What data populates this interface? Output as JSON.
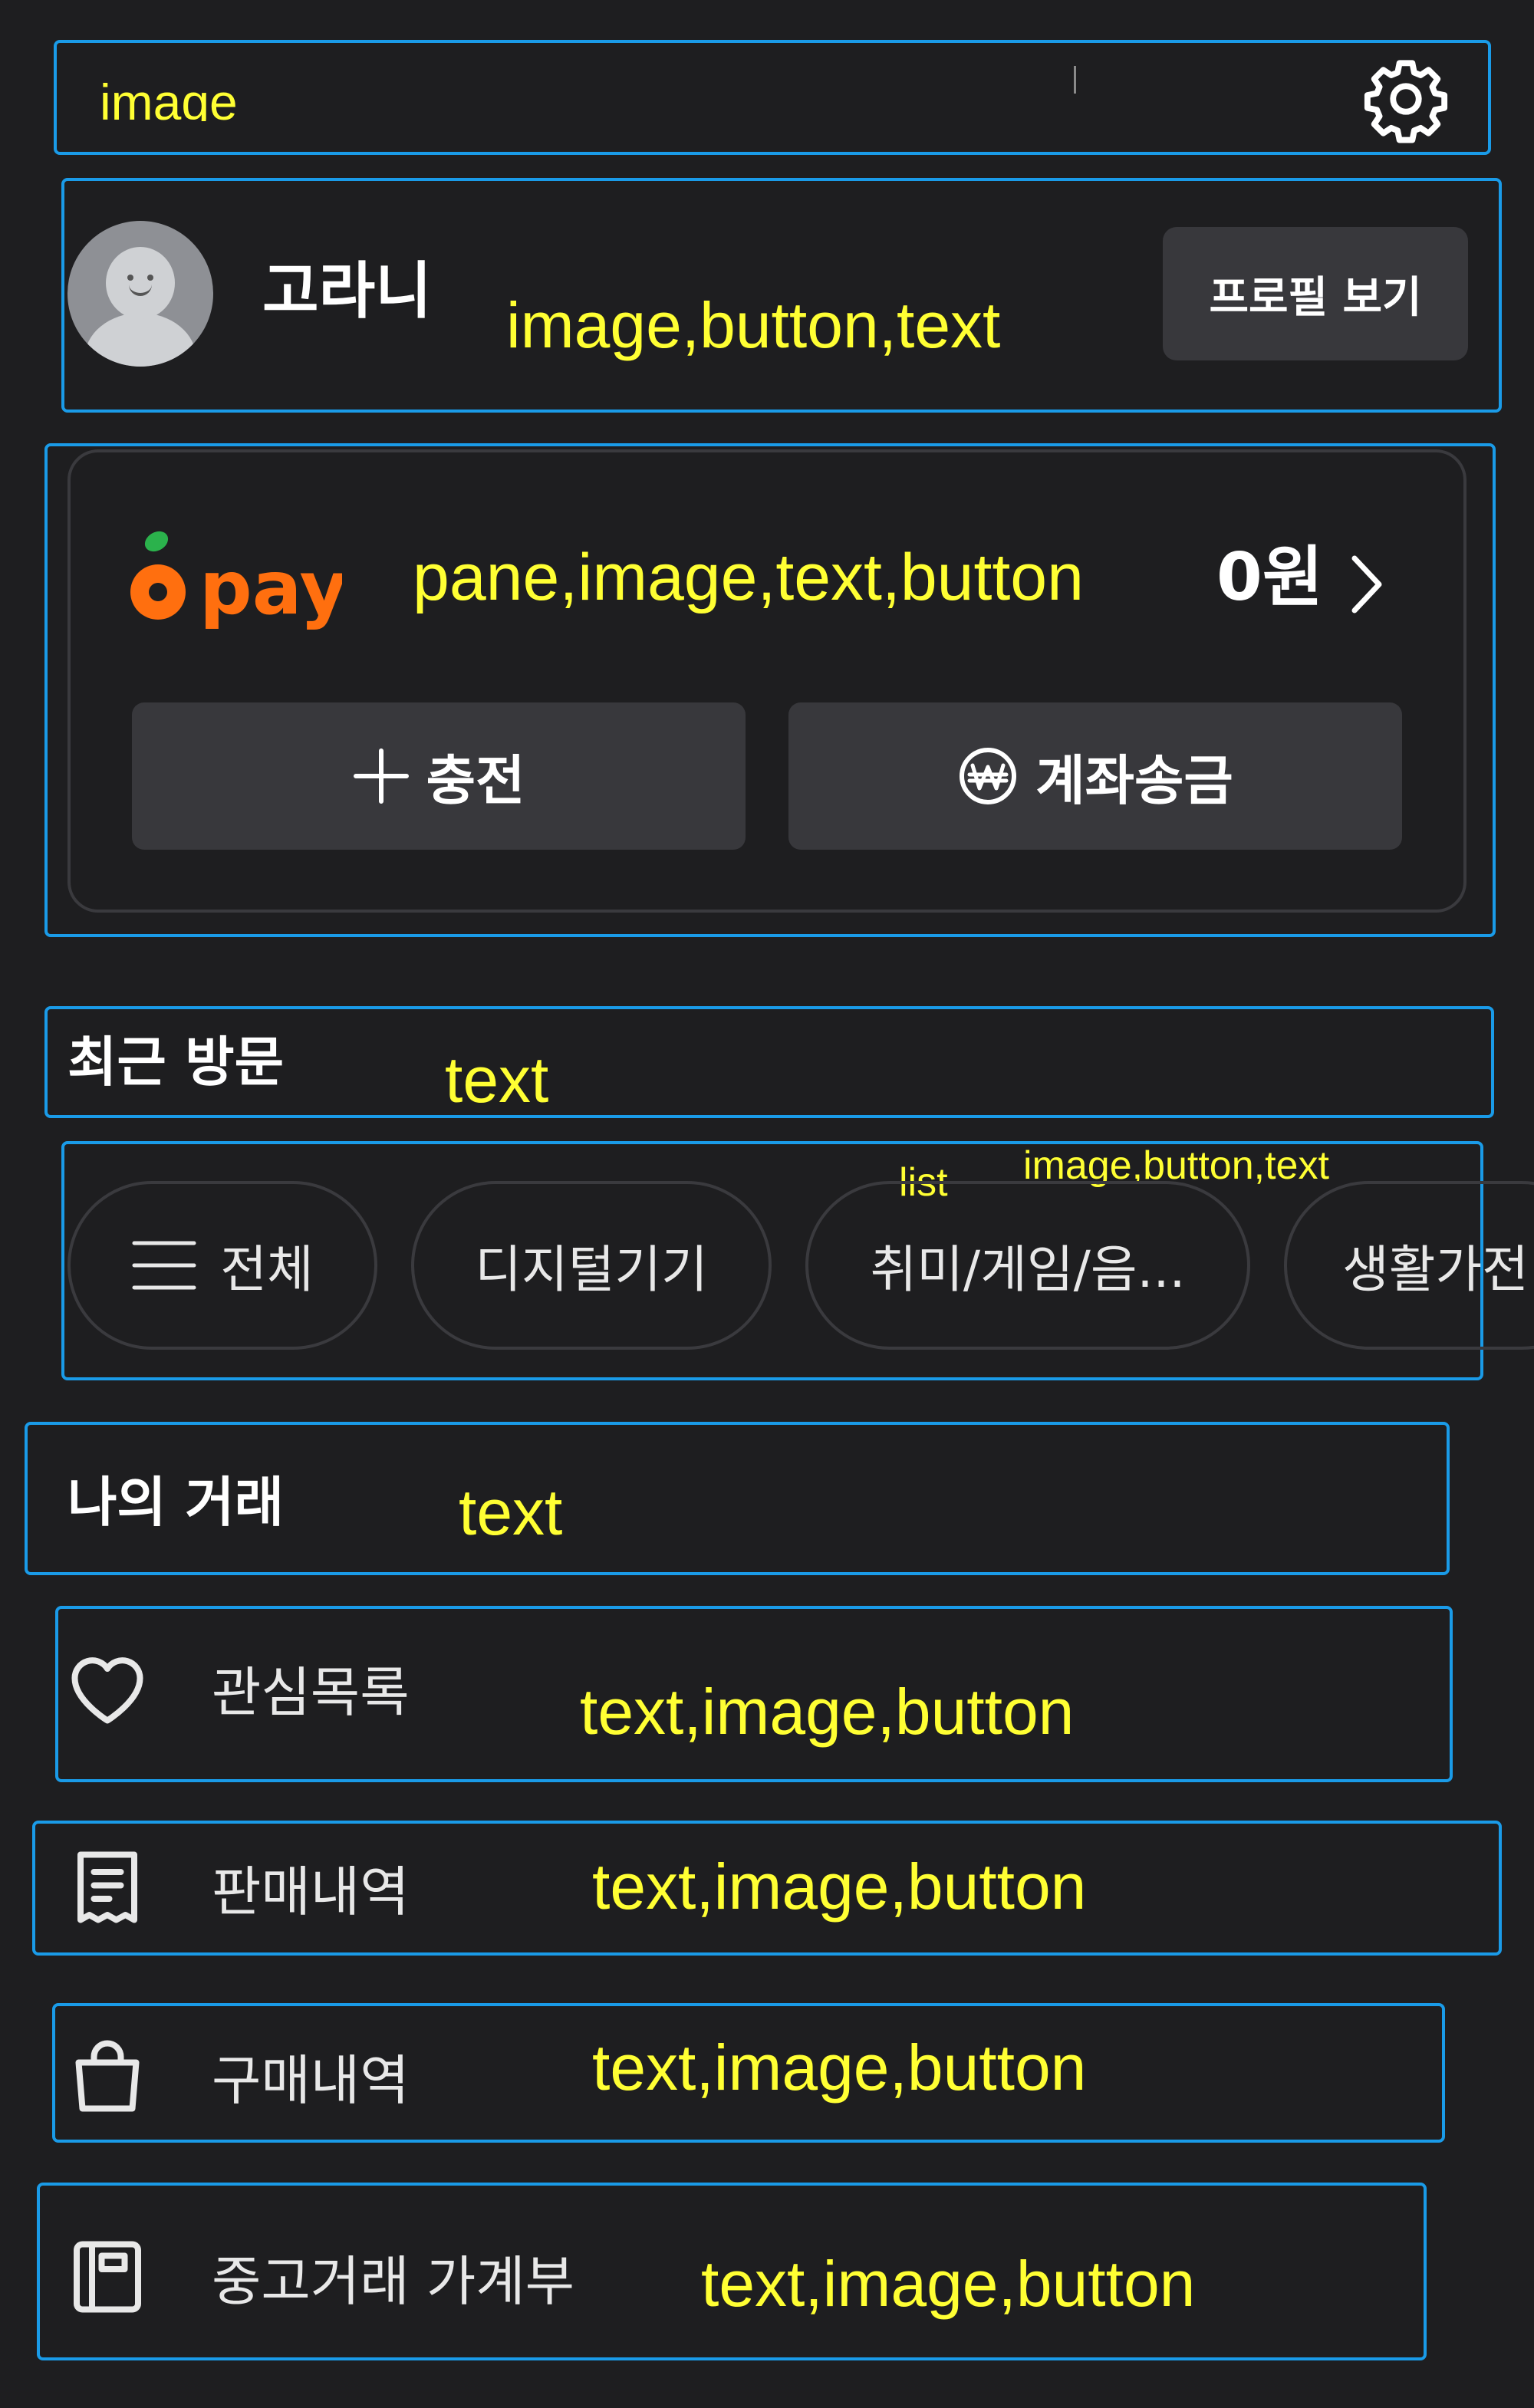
{
  "header": {
    "cut_text": "image",
    "settings_icon": "gear-icon"
  },
  "profile": {
    "avatar_icon": "avatar",
    "nickname": "고라니",
    "view_profile_label": "프로필 보기"
  },
  "pay": {
    "logo_text": "pay",
    "balance": "0원",
    "charge_label": "충전",
    "transfer_label": "계좌송금",
    "accent": "#ff6f0f",
    "leaf": "#2bb24c"
  },
  "recent": {
    "title": "최근 방문",
    "chips": [
      {
        "label": "전체",
        "icon": "menu-icon"
      },
      {
        "label": "디지털기기"
      },
      {
        "label": "취미/게임/음..."
      },
      {
        "label": "생활가전"
      }
    ]
  },
  "trades": {
    "title": "나의 거래",
    "items": [
      {
        "label": "관심목록",
        "icon": "heart-icon"
      },
      {
        "label": "판매내역",
        "icon": "receipt-icon"
      },
      {
        "label": "구매내역",
        "icon": "shopping-bag-icon"
      },
      {
        "label": "중고거래 가계부",
        "icon": "ledger-icon"
      }
    ]
  },
  "annotations": {
    "profile": "image,button,text",
    "pay": "pane,image,text,button",
    "recent_title": "text",
    "list": "list",
    "chips": "image,button,text",
    "trades_title": "text",
    "item1": "text,image,button",
    "item2": "text,image,button",
    "item3": "text,image,button",
    "item4": "text,image,button"
  },
  "colors": {
    "background": "#1e1e20",
    "annotation_box": "#1a9be8",
    "annotation_text": "#ffff33"
  }
}
